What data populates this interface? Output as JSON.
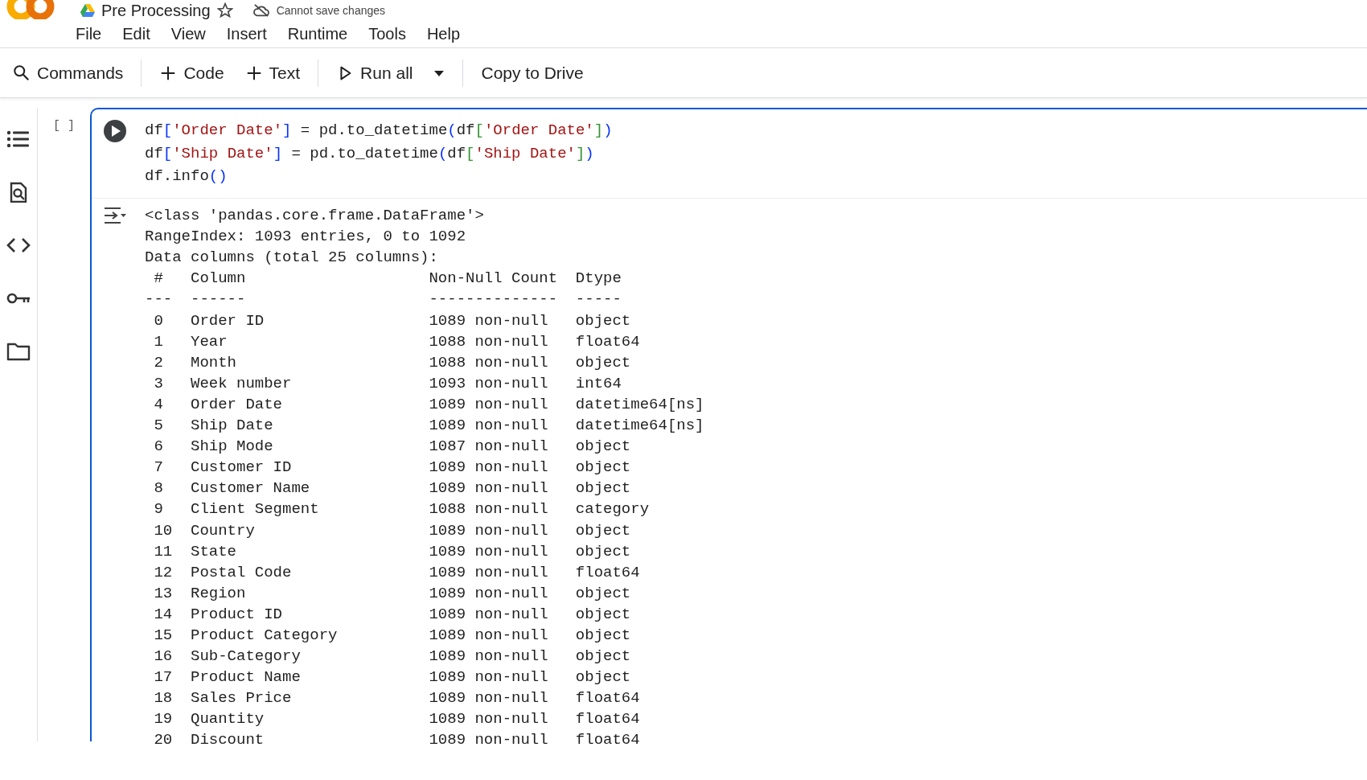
{
  "app": {
    "title": "Pre Processing",
    "starred": false,
    "save_status": "Cannot save changes"
  },
  "menu": [
    "File",
    "Edit",
    "View",
    "Insert",
    "Runtime",
    "Tools",
    "Help"
  ],
  "toolbar": [
    [
      {
        "kind": "search",
        "label": "Commands"
      }
    ],
    [
      {
        "kind": "add",
        "label": "Code"
      },
      {
        "kind": "add",
        "label": "Text"
      }
    ],
    [
      {
        "kind": "run",
        "label": "Run all"
      }
    ],
    [
      {
        "kind": "plain",
        "label": "Copy to Drive"
      }
    ]
  ],
  "cell": {
    "execution_count": "[ ]",
    "focused": true,
    "code": [
      [
        {
          "kind": "text",
          "text": "df"
        },
        {
          "kind": "bracket1",
          "text": "["
        },
        {
          "kind": "string",
          "text": "'Order Date'"
        },
        {
          "kind": "bracket1",
          "text": "]"
        },
        {
          "kind": "text",
          "text": " = pd.to_datetime"
        },
        {
          "kind": "bracket1",
          "text": "("
        },
        {
          "kind": "text",
          "text": "df"
        },
        {
          "kind": "bracket2",
          "text": "["
        },
        {
          "kind": "string",
          "text": "'Order Date'"
        },
        {
          "kind": "bracket2",
          "text": "]"
        },
        {
          "kind": "bracket1",
          "text": ")"
        }
      ],
      [
        {
          "kind": "text",
          "text": "df"
        },
        {
          "kind": "bracket1",
          "text": "["
        },
        {
          "kind": "string",
          "text": "'Ship Date'"
        },
        {
          "kind": "bracket1",
          "text": "]"
        },
        {
          "kind": "text",
          "text": " = pd.to_datetime"
        },
        {
          "kind": "bracket1",
          "text": "("
        },
        {
          "kind": "text",
          "text": "df"
        },
        {
          "kind": "bracket2",
          "text": "["
        },
        {
          "kind": "string",
          "text": "'Ship Date'"
        },
        {
          "kind": "bracket2",
          "text": "]"
        },
        {
          "kind": "bracket1",
          "text": ")"
        }
      ],
      [
        {
          "kind": "text",
          "text": "df.info"
        },
        {
          "kind": "bracket1",
          "text": "()"
        }
      ]
    ],
    "output": {
      "lines": [
        "<class 'pandas.core.frame.DataFrame'>",
        "RangeIndex: 1093 entries, 0 to 1092",
        "Data columns (total 25 columns):"
      ],
      "header": {
        "index": "#",
        "column": "Column",
        "count": "Non-Null Count",
        "dtype": "Dtype"
      },
      "rule": {
        "index": "---",
        "column": "------",
        "count": "--------------",
        "dtype": "-----"
      },
      "rows": [
        {
          "index": "0",
          "column": "Order ID",
          "count": "1089 non-null",
          "dtype": "object"
        },
        {
          "index": "1",
          "column": "Year",
          "count": "1088 non-null",
          "dtype": "float64"
        },
        {
          "index": "2",
          "column": "Month",
          "count": "1088 non-null",
          "dtype": "object"
        },
        {
          "index": "3",
          "column": "Week number",
          "count": "1093 non-null",
          "dtype": "int64"
        },
        {
          "index": "4",
          "column": "Order Date",
          "count": "1089 non-null",
          "dtype": "datetime64[ns]"
        },
        {
          "index": "5",
          "column": "Ship Date",
          "count": "1089 non-null",
          "dtype": "datetime64[ns]"
        },
        {
          "index": "6",
          "column": "Ship Mode",
          "count": "1087 non-null",
          "dtype": "object"
        },
        {
          "index": "7",
          "column": "Customer ID",
          "count": "1089 non-null",
          "dtype": "object"
        },
        {
          "index": "8",
          "column": "Customer Name",
          "count": "1089 non-null",
          "dtype": "object"
        },
        {
          "index": "9",
          "column": "Client Segment",
          "count": "1088 non-null",
          "dtype": "category"
        },
        {
          "index": "10",
          "column": "Country",
          "count": "1089 non-null",
          "dtype": "object"
        },
        {
          "index": "11",
          "column": "State",
          "count": "1089 non-null",
          "dtype": "object"
        },
        {
          "index": "12",
          "column": "Postal Code",
          "count": "1089 non-null",
          "dtype": "float64"
        },
        {
          "index": "13",
          "column": "Region",
          "count": "1089 non-null",
          "dtype": "object"
        },
        {
          "index": "14",
          "column": "Product ID",
          "count": "1089 non-null",
          "dtype": "object"
        },
        {
          "index": "15",
          "column": "Product Category",
          "count": "1089 non-null",
          "dtype": "object"
        },
        {
          "index": "16",
          "column": "Sub-Category",
          "count": "1089 non-null",
          "dtype": "object"
        },
        {
          "index": "17",
          "column": "Product Name",
          "count": "1089 non-null",
          "dtype": "object"
        },
        {
          "index": "18",
          "column": "Sales Price",
          "count": "1089 non-null",
          "dtype": "float64"
        },
        {
          "index": "19",
          "column": "Quantity",
          "count": "1089 non-null",
          "dtype": "float64"
        },
        {
          "index": "20",
          "column": "Discount",
          "count": "1089 non-null",
          "dtype": "float64"
        }
      ]
    }
  }
}
